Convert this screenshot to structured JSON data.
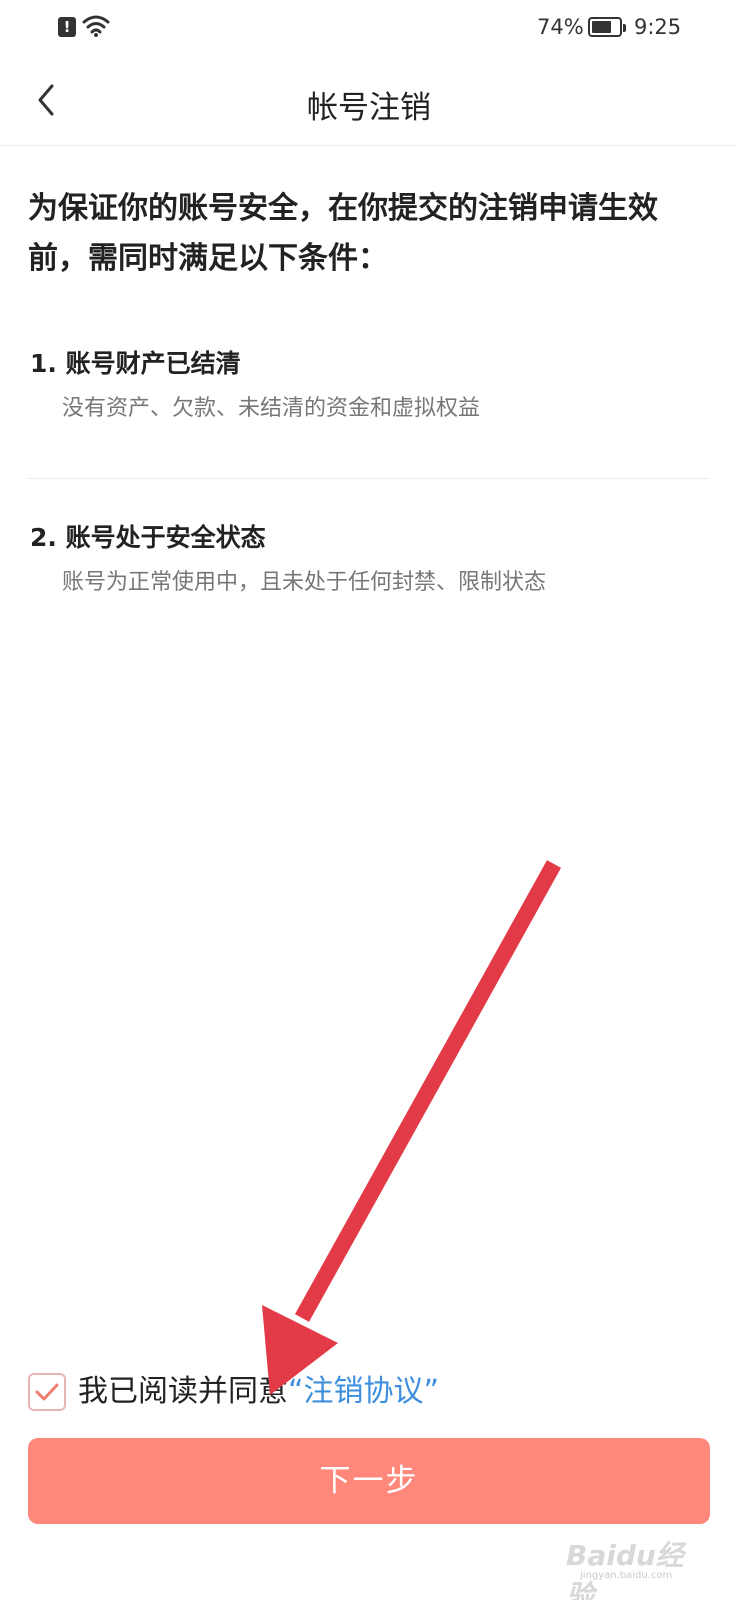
{
  "status_bar": {
    "battery_percent": "74%",
    "battery_level": 0.74,
    "time": "9:25",
    "icons": [
      "alert-icon",
      "wifi-icon",
      "battery-icon"
    ]
  },
  "nav": {
    "back_icon": "chevron-left-icon",
    "title": "帐号注销"
  },
  "intro": "为保证你的账号安全，在你提交的注销申请生效前，需同时满足以下条件：",
  "conditions": [
    {
      "title": "1. 账号财产已结清",
      "desc": "没有资产、欠款、未结清的资金和虚拟权益"
    },
    {
      "title": "2. 账号处于安全状态",
      "desc": "账号为正常使用中，且未处于任何封禁、限制状态"
    }
  ],
  "agreement": {
    "checked": true,
    "text": "我已阅读并同意",
    "link_text": "“注销协议”"
  },
  "next_button": {
    "label": "下一步"
  },
  "colors": {
    "primary_button": "#ff887b",
    "link": "#3d8fde",
    "checkbox_check": "#f07d6f",
    "annotation_arrow": "#e23a47"
  },
  "watermark": {
    "text": "Baidu经验",
    "sub": "jingyan.baidu.com"
  }
}
